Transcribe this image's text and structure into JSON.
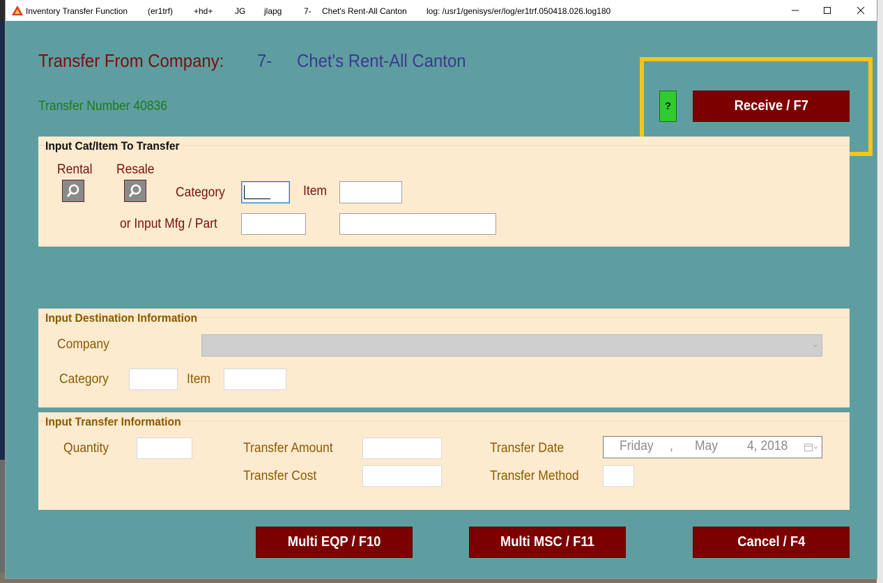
{
  "titlebar": {
    "app_title": "Inventory Transfer Function",
    "program": "(er1trf)",
    "host": "+hd+",
    "user_initials": "JG",
    "user": "jlapg",
    "company_no": "7-",
    "company_name": "Chet's Rent-All Canton",
    "log": "log: /usr1/genisys/er/log/er1trf.050418.026.log180",
    "minimize": "—",
    "maximize": "☐",
    "close": "✕"
  },
  "header": {
    "transfer_from_label": "Transfer From Company:",
    "company_number": "7-",
    "company_name": "Chet's Rent-All Canton",
    "transfer_number_label": "Transfer Number 40836",
    "help_label": "?",
    "receive_button": "Receive / F7"
  },
  "input_item": {
    "title": "Input Cat/Item To Transfer",
    "rental_label": "Rental",
    "resale_label": "Resale",
    "category_label": "Category",
    "item_label": "Item",
    "mfg_part_label": "or Input Mfg / Part",
    "category_value": "",
    "item_value": "",
    "mfg_value": "",
    "part_value": ""
  },
  "destination": {
    "title": "Input Destination Information",
    "company_label": "Company",
    "company_value": "",
    "category_label": "Category",
    "item_label": "Item",
    "category_value": "",
    "item_value": ""
  },
  "transfer_info": {
    "title": "Input Transfer Information",
    "quantity_label": "Quantity",
    "amount_label": "Transfer Amount",
    "cost_label": "Transfer Cost",
    "date_label": "Transfer Date",
    "method_label": "Transfer Method",
    "date_weekday": "Friday",
    "date_sep": ",",
    "date_month": "May",
    "date_day_year": "4, 2018"
  },
  "buttons": {
    "multi_eqp": "Multi EQP / F10",
    "multi_msc": "Multi MSC / F11",
    "cancel": "Cancel / F4"
  },
  "colors": {
    "window_bg": "#5f9ea0",
    "panel_bg": "#fdebd0",
    "button_bg": "#7d0000",
    "highlight": "#f5c518",
    "help_green": "#2ecc2e"
  },
  "icons": {
    "app": "app-logo-icon",
    "lookup": "magnifier-icon",
    "calendar": "calendar-icon",
    "dropdown": "chevron-down-icon"
  }
}
